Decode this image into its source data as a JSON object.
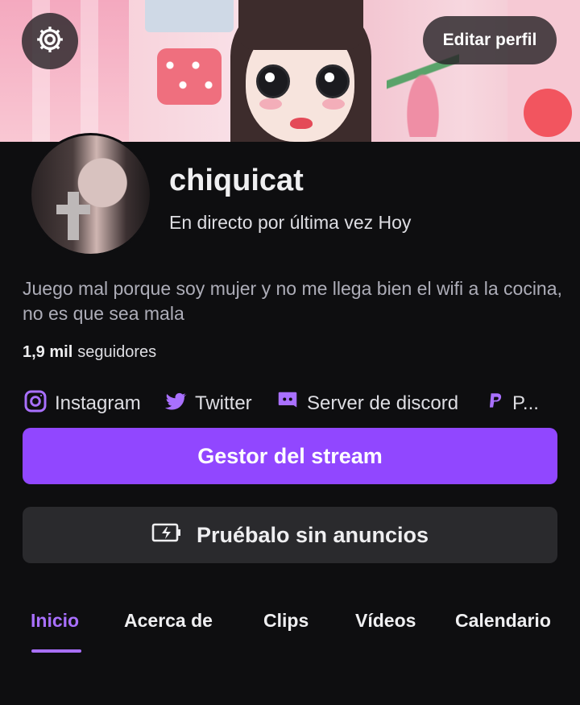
{
  "header": {
    "edit_profile_label": "Editar perfil",
    "settings_icon": "gear-icon"
  },
  "profile": {
    "username": "chiquicat",
    "last_live": "En directo por última vez Hoy",
    "bio": "Juego mal porque soy mujer y no me llega bien el wifi a la cocina, no es que sea mala",
    "followers_count": "1,9 mil",
    "followers_label": "seguidores"
  },
  "social_links": [
    {
      "label": "Instagram",
      "icon": "instagram-icon"
    },
    {
      "label": "Twitter",
      "icon": "twitter-icon"
    },
    {
      "label": "Server de discord",
      "icon": "discord-icon"
    },
    {
      "label": "P...",
      "icon": "paypal-icon"
    }
  ],
  "actions": {
    "primary_label": "Gestor del stream",
    "secondary_label": "Pruébalo sin anuncios",
    "secondary_icon": "battery-charging-icon"
  },
  "tabs": [
    {
      "label": "Inicio",
      "active": true
    },
    {
      "label": "Acerca de",
      "active": false
    },
    {
      "label": "Clips",
      "active": false
    },
    {
      "label": "Vídeos",
      "active": false
    },
    {
      "label": "Calendario",
      "active": false
    }
  ],
  "colors": {
    "background": "#0e0e10",
    "accent": "#9147ff",
    "accent_text": "#a970ff",
    "secondary_button": "#2a2a2d"
  }
}
